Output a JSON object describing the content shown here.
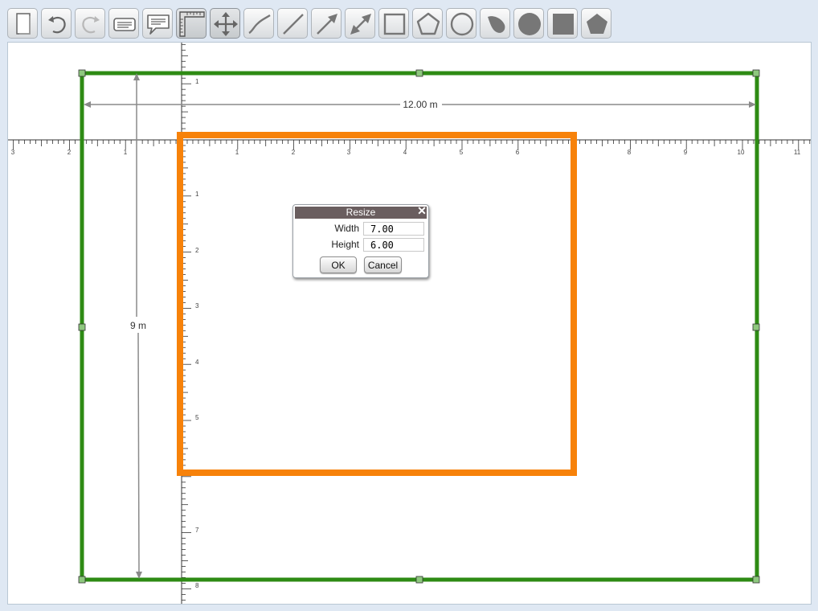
{
  "toolbar": {
    "tools": [
      {
        "name": "new-page-icon"
      },
      {
        "name": "undo-icon"
      },
      {
        "name": "redo-icon"
      },
      {
        "name": "text-box-icon"
      },
      {
        "name": "callout-icon"
      },
      {
        "name": "ruler-icon",
        "active": true
      },
      {
        "name": "move-icon",
        "active": true
      },
      {
        "name": "curve-icon"
      },
      {
        "name": "line-icon"
      },
      {
        "name": "arrow-icon"
      },
      {
        "name": "double-arrow-icon"
      },
      {
        "name": "rectangle-icon"
      },
      {
        "name": "pentagon-icon"
      },
      {
        "name": "circle-icon"
      },
      {
        "name": "filled-blob-icon"
      },
      {
        "name": "filled-circle-icon"
      },
      {
        "name": "filled-square-icon"
      },
      {
        "name": "filled-pentagon-icon"
      }
    ]
  },
  "ruler": {
    "x_labels": [
      "3",
      "2",
      "1",
      "1",
      "2",
      "3",
      "4",
      "5",
      "6",
      "7",
      "8",
      "9",
      "10",
      "11"
    ],
    "y_labels": [
      "1",
      "1",
      "2",
      "3",
      "4",
      "5",
      "6",
      "7",
      "8"
    ]
  },
  "shapes": {
    "outer_rect": {
      "color": "#2e8b14",
      "width_m": 12,
      "height_m": 9
    },
    "inner_rect": {
      "color": "#f7820a",
      "width_m": 7,
      "height_m": 6
    }
  },
  "dimensions": {
    "width_label": "12.00 m",
    "height_label": "9 m",
    "line_color": "#8a8a8a"
  },
  "dialog": {
    "title": "Resize",
    "width_label": "Width",
    "width_value": "7.00",
    "height_label": "Height",
    "height_value": "6.00",
    "ok_label": "OK",
    "cancel_label": "Cancel"
  }
}
